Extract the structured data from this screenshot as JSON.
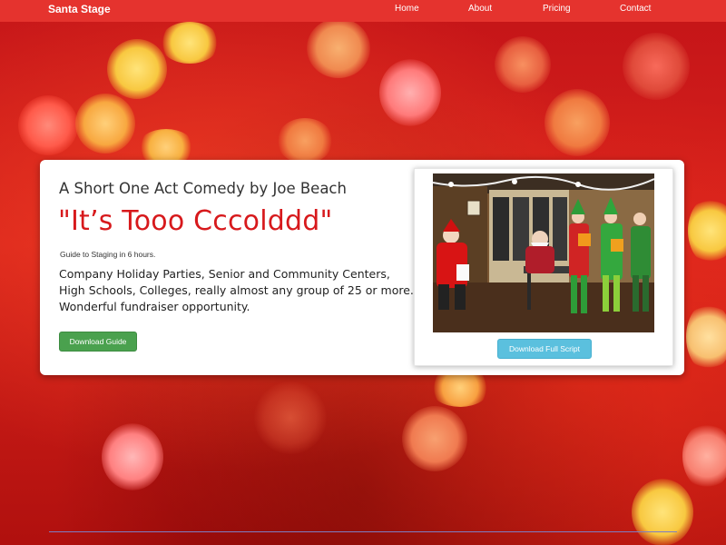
{
  "navbar": {
    "brand": "Santa Stage",
    "items": [
      "Home",
      "About",
      "Pricing",
      "Contact"
    ]
  },
  "hero": {
    "subtitle": "A Short One Act Comedy by Joe Beach",
    "title": "\"It’s Tooo Cccolddd\"",
    "guide_note": "Guide to Staging in 6 hours.",
    "description": "Company Holiday Parties, Senior and Community Centers, High Schools, Colleges, really almost any group of 25 or more. Wonderful fundraiser opportunity.",
    "download_guide_label": "Download Guide",
    "download_script_label": "Download Full Script"
  },
  "colors": {
    "navbar": "#e5332e",
    "title_red": "#d7191c",
    "button_green": "#4aa14e",
    "button_blue": "#5bc0de"
  },
  "icons": {
    "photo": "theater-photo"
  }
}
